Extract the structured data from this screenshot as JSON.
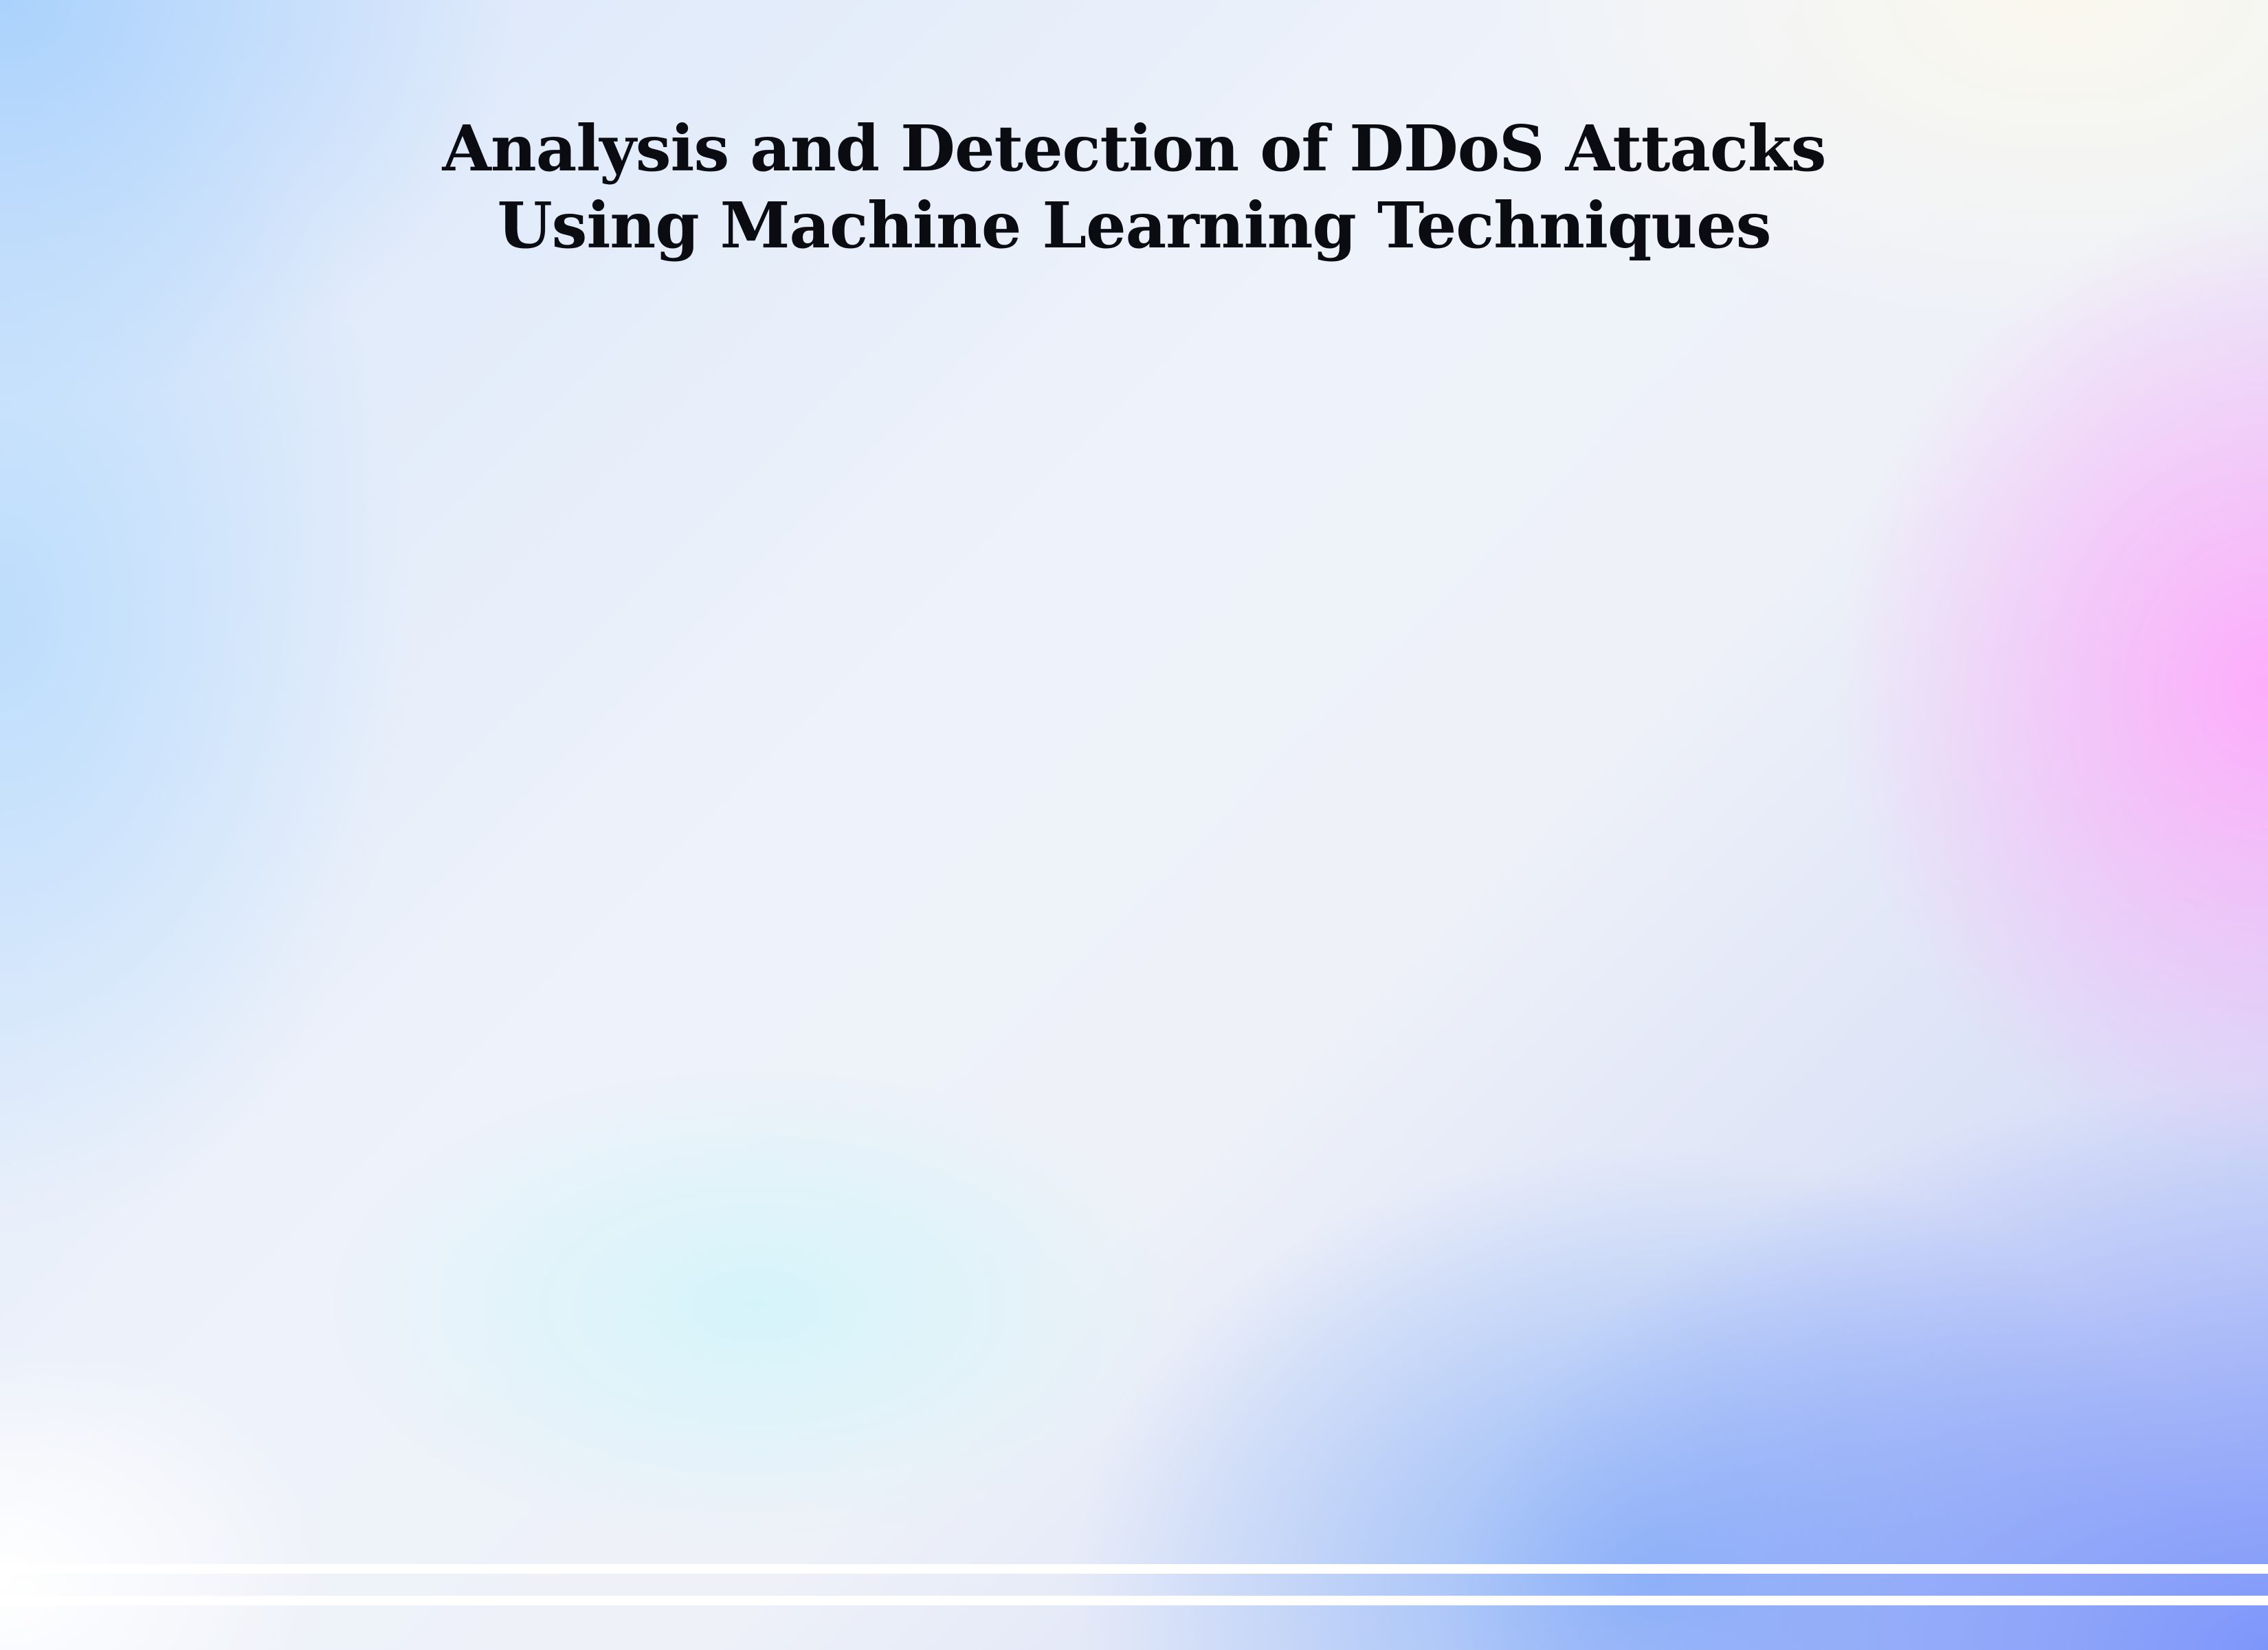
{
  "slide": {
    "title_line_1": "Analysis and Detection of DDoS Attacks",
    "title_line_2": "Using Machine Learning Techniques"
  },
  "colors": {
    "title_text": "#0b0b12",
    "stripe": "#ffffff",
    "accent_pink": "#ffaafa",
    "accent_blue": "#7d96fa",
    "accent_light_blue": "#aad2fc"
  }
}
